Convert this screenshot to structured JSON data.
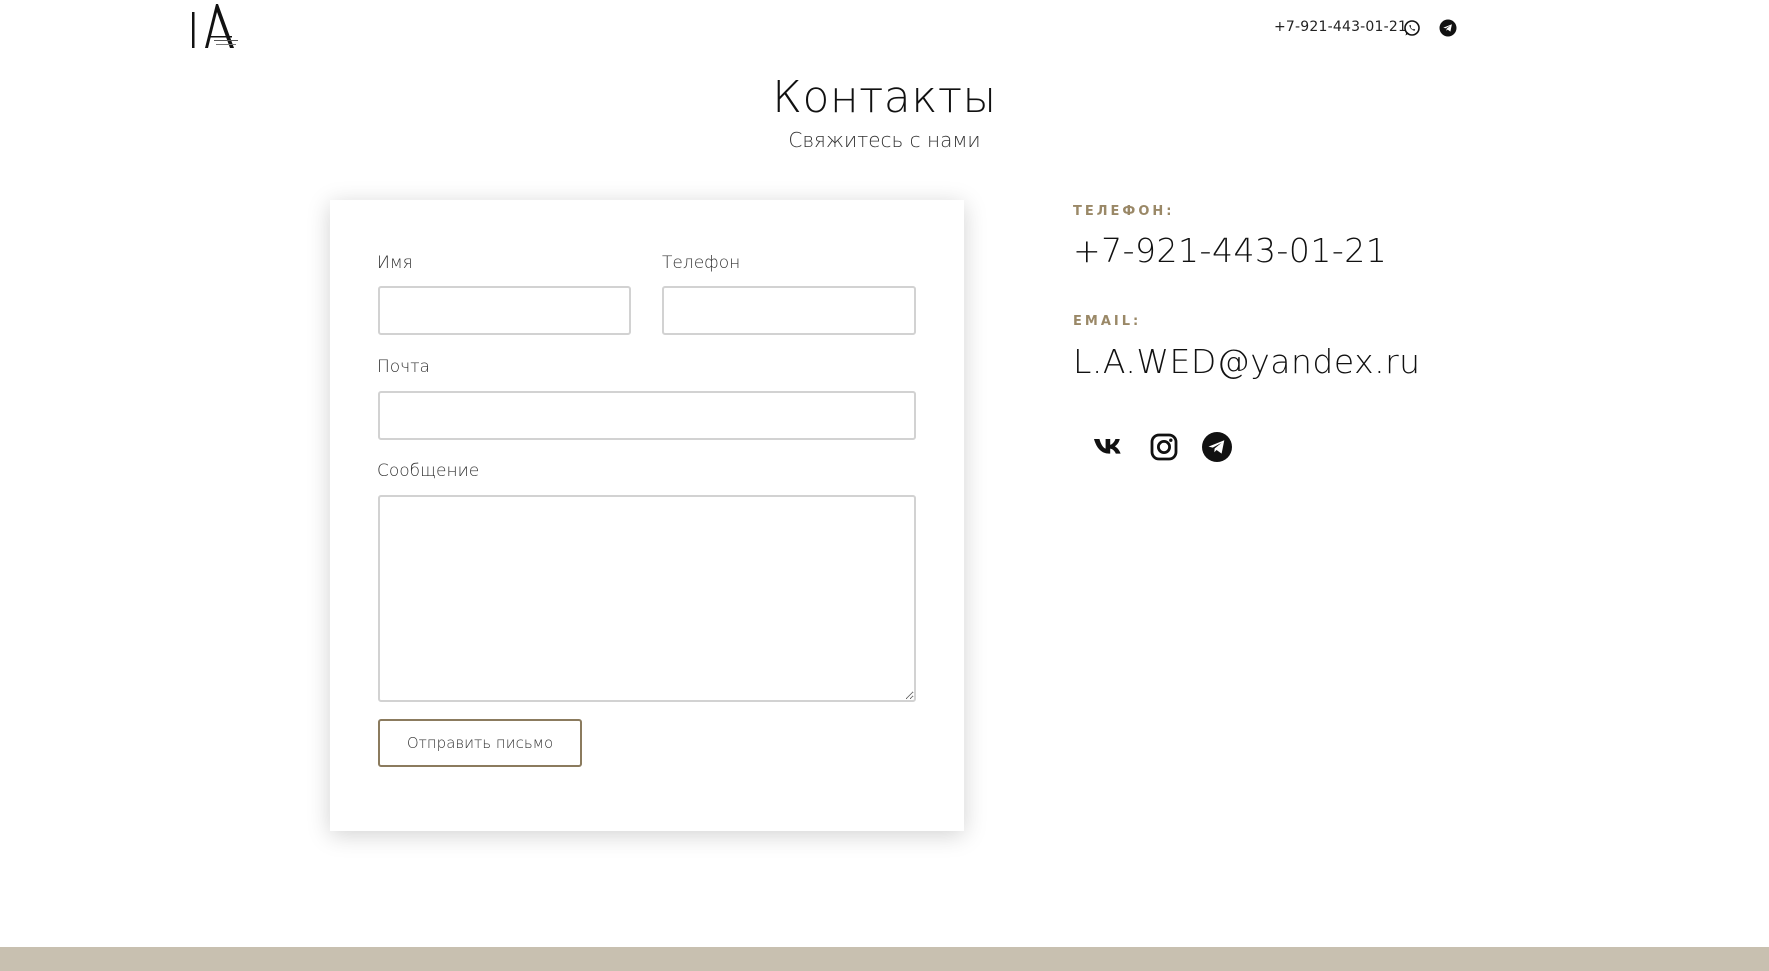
{
  "header": {
    "logo_text": "LA",
    "phone": "+7-921-443-01-21",
    "icons": [
      "whatsapp-icon",
      "telegram-icon"
    ]
  },
  "title": {
    "heading": "Контакты",
    "subheading": "Свяжитесь с нами"
  },
  "form": {
    "name_label": "Имя",
    "name_value": "",
    "phone_label": "Телефон",
    "phone_value": "",
    "email_label": "Почта",
    "email_value": "",
    "message_label": "Сообщение",
    "message_value": "",
    "submit_label": "Отправить письмо"
  },
  "contacts": {
    "phone_caption": "ТЕЛЕФОН:",
    "phone_value": "+7-921-443-01-21",
    "email_caption": "EMAIL:",
    "email_value": "L.A.WED@yandex.ru",
    "social": [
      "vk-icon",
      "instagram-icon",
      "telegram-icon"
    ]
  },
  "colors": {
    "accent": "#9a8867",
    "button_border": "#8b7b5e",
    "footer": "#c8c0b0"
  }
}
